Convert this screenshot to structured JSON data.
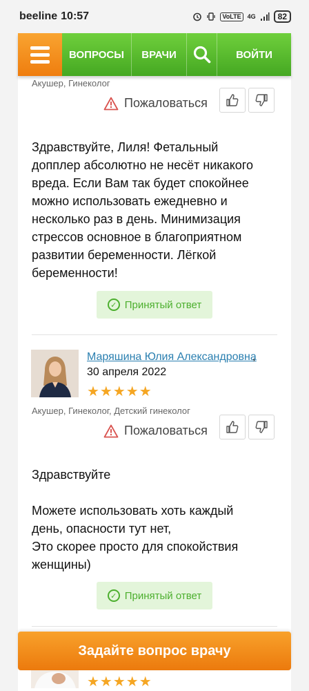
{
  "status_bar": {
    "carrier": "beeline",
    "time": "10:57",
    "network": "4G",
    "volte": "VoLTE",
    "battery": "82"
  },
  "nav": {
    "questions": "ВОПРОСЫ",
    "doctors": "ВРАЧИ",
    "login": "ВОЙТИ"
  },
  "answer1": {
    "specialty": "Акушер, Гинеколог",
    "complain_label": "Пожаловаться",
    "text": "Здравствуйте, Лиля! Фетальный допплер абсолютно не несёт никакого вреда. Если Вам так будет спокойнее можно использовать ежедневно и несколько раз в день. Минимизация стрессов основное в благоприятном развитии беременности. Лёгкой беременности!",
    "accepted_label": "Принятый ответ"
  },
  "answer2": {
    "doctor_name": "Маряшина Юлия Александровна",
    "date": "30 апреля 2022",
    "stars": "★★★★★",
    "specialty": "Акушер, Гинеколог, Детский гинеколог",
    "complain_label": "Пожаловаться",
    "greeting": "Здравствуйте",
    "text": "Можете использовать хоть каждый день, опасности тут нет,\nЭто скорее просто для спокойствия женщины)",
    "accepted_label": "Принятый ответ"
  },
  "answer3": {
    "stars": "★★★★★"
  },
  "cta_label": "Задайте вопрос врачу",
  "colors": {
    "orange": "#f08a1c",
    "green": "#52b82b",
    "link": "#2a7fb0",
    "star": "#f5a623"
  }
}
